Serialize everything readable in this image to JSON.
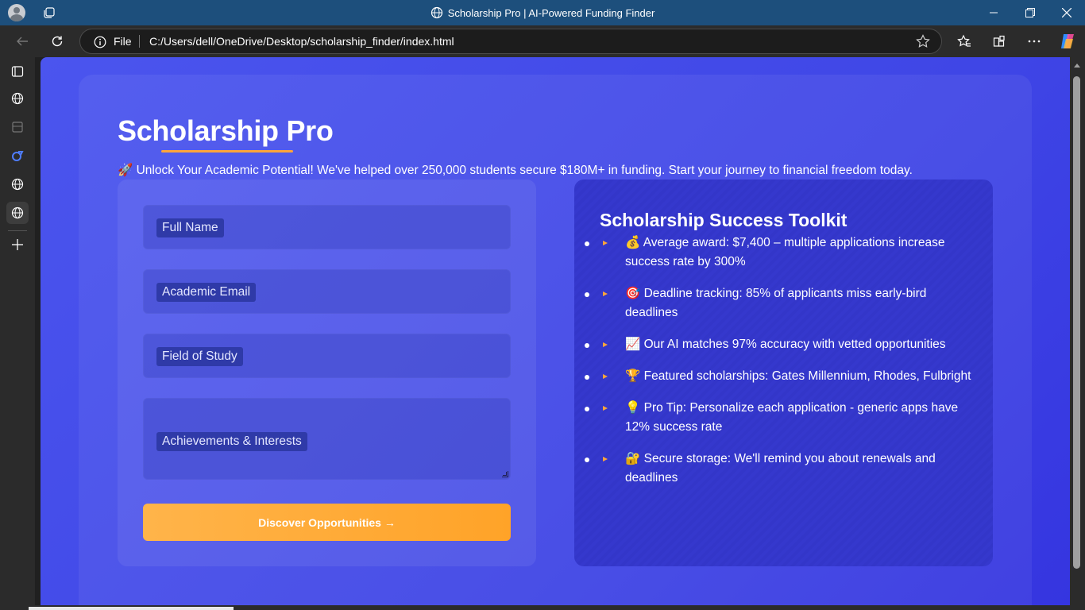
{
  "browser": {
    "window_title": "Scholarship Pro | AI-Powered Funding Finder",
    "address_scheme": "File",
    "url": "C:/Users/dell/OneDrive/Desktop/scholarship_finder/index.html"
  },
  "page": {
    "title": "Scholarship Pro",
    "subtitle": "🚀 Unlock Your Academic Potential! We've helped over 250,000 students secure $180M+ in funding. Start your journey to financial freedom today.",
    "form": {
      "full_name_placeholder": "Full Name",
      "email_placeholder": "Academic Email",
      "field_placeholder": "Field of Study",
      "achievements_placeholder": "Achievements & Interests",
      "submit_label": "Discover Opportunities →"
    },
    "toolkit": {
      "title": "Scholarship Success Toolkit",
      "items": [
        "💰 Average award: $7,400 – multiple applications increase success rate by 300%",
        "🎯 Deadline tracking: 85% of applicants miss early-bird deadlines",
        "📈 Our AI matches 97% accuracy with vetted opportunities",
        "🏆 Featured scholarships: Gates Millennium, Rhodes, Fulbright",
        "💡 Pro Tip: Personalize each application - generic apps have 12% success rate",
        "🔐 Secure storage: We'll remind you about renewals and deadlines"
      ]
    }
  },
  "colors": {
    "accent": "#ffa53a",
    "page_bg": "#4148e8",
    "titlebar": "#1d4f7c"
  },
  "icons": [
    "profile-icon",
    "tabs-icon",
    "globe-icon",
    "minimize-icon",
    "restore-icon",
    "close-icon",
    "back-icon",
    "refresh-icon",
    "info-icon",
    "favorite-star-icon",
    "favorites-icon",
    "collections-icon",
    "more-icon",
    "copilot-icon",
    "vertical-tabs-icon",
    "add-tab-icon"
  ]
}
